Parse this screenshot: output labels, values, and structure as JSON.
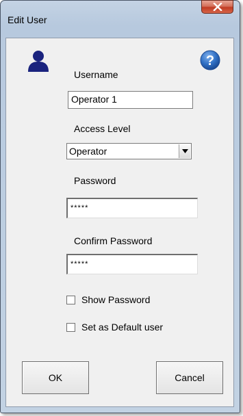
{
  "window": {
    "title": "Edit User",
    "close_symbol": "X"
  },
  "form": {
    "user_icon": "user-icon",
    "help_icon": "help-icon",
    "help_symbol": "?",
    "username_label": "Username",
    "username_value": "Operator 1",
    "access_level_label": "Access Level",
    "access_level_value": "Operator",
    "password_label": "Password",
    "password_value": "*****",
    "confirm_password_label": "Confirm Password",
    "confirm_password_value": "*****",
    "show_password_label": "Show Password",
    "show_password_checked": false,
    "default_user_label": "Set as Default user",
    "default_user_checked": false
  },
  "buttons": {
    "ok_label": "OK",
    "cancel_label": "Cancel"
  },
  "colors": {
    "user_icon": "#1a237e",
    "help_icon": "#2f6fc4",
    "close_button": "#c9452c"
  }
}
